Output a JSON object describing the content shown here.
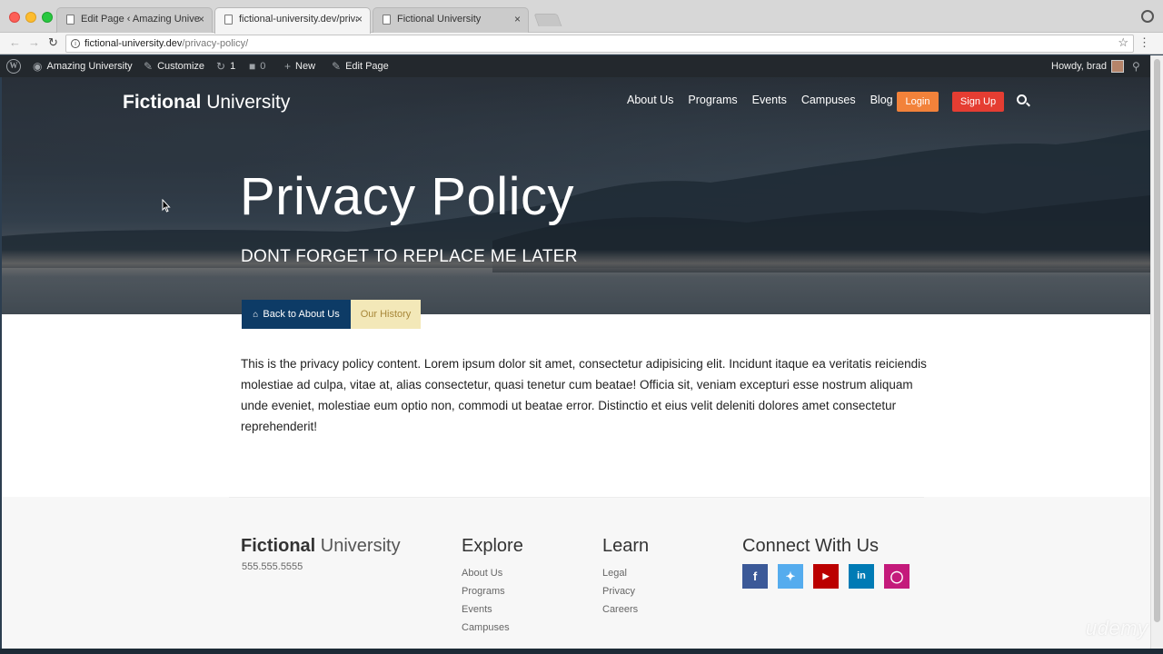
{
  "browser": {
    "tabs": [
      {
        "label": "Edit Page ‹ Amazing University",
        "close": "×"
      },
      {
        "label": "fictional-university.dev/privacy-policy/",
        "close": "×"
      },
      {
        "label": "Fictional University",
        "close": "×"
      }
    ],
    "url": {
      "host": "fictional-university.dev",
      "path": "/privacy-policy/"
    },
    "icons": [
      "back-icon",
      "forward-icon",
      "reload-icon",
      "info-icon",
      "star-icon",
      "menu-icon",
      "profile-icon"
    ]
  },
  "adminbar": {
    "site_name": "Amazing University",
    "customize": "Customize",
    "updates_count": "1",
    "comments_count": "0",
    "new": "New",
    "edit_page": "Edit Page",
    "greeting": "Howdy, brad"
  },
  "header": {
    "logo_bold": "Fictional",
    "logo_light": "University",
    "nav": [
      "About Us",
      "Programs",
      "Events",
      "Campuses",
      "Blog"
    ],
    "login": "Login",
    "signup": "Sign Up"
  },
  "hero": {
    "title": "Privacy Policy",
    "subtitle": "DONT FORGET TO REPLACE ME LATER"
  },
  "metabox": {
    "back_label": "Back to About Us",
    "child_label": "Our History"
  },
  "content": {
    "body": "This is the privacy policy content. Lorem ipsum dolor sit amet, consectetur adipisicing elit. Incidunt itaque ea veritatis reiciendis molestiae ad culpa, vitae at, alias consectetur, quasi tenetur cum beatae! Officia sit, veniam excepturi esse nostrum aliquam unde eveniet, molestiae eum optio non, commodi ut beatae error. Distinctio et eius velit deleniti dolores amet consectetur reprehenderit!"
  },
  "footer": {
    "logo_bold": "Fictional",
    "logo_light": "University",
    "phone": "555.555.5555",
    "explore": {
      "title": "Explore",
      "links": [
        "About Us",
        "Programs",
        "Events",
        "Campuses"
      ]
    },
    "learn": {
      "title": "Learn",
      "links": [
        "Legal",
        "Privacy",
        "Careers"
      ]
    },
    "connect": {
      "title": "Connect With Us",
      "icons": [
        "facebook-icon",
        "twitter-icon",
        "youtube-icon",
        "linkedin-icon",
        "instagram-icon"
      ]
    }
  },
  "watermark": "udemy",
  "colors": {
    "login": "#f2823a",
    "signup": "#e53d32",
    "back_button": "#0d3b66",
    "child_button": "#f3e8b8",
    "adminbar": "#23282d"
  }
}
